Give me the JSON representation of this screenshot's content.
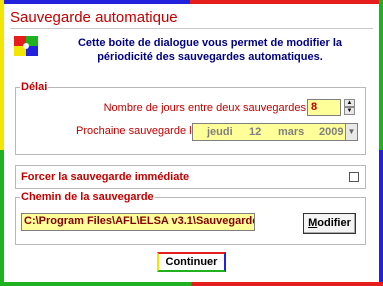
{
  "window": {
    "title": "Sauvegarde automatique",
    "intro_line1": "Cette boite de dialogue vous permet de modifier la",
    "intro_line2": "périodicité des sauvegardes automatiques."
  },
  "delai": {
    "group_label": "Délai",
    "jours_label": "Nombre de jours entre deux sauvegardes",
    "jours_value": "8",
    "prochaine_label": "Prochaine sauvegarde le",
    "date_weekday": "jeudi",
    "date_day": "12",
    "date_month": "mars",
    "date_year": "2009"
  },
  "forcer": {
    "label": "Forcer la sauvegarde immédiate",
    "checked": false
  },
  "chemin": {
    "group_label": "Chemin de la sauvegarde",
    "path_value": "C:\\Program Files\\AFL\\ELSA v3.1\\Sauvegarde",
    "modifier_label_first": "M",
    "modifier_label_rest": "odifier"
  },
  "footer": {
    "continuer_label": "Continuer"
  },
  "colors": {
    "title_red": "#c00000",
    "intro_blue": "#00007f",
    "field_yellow": "#ffff99",
    "border_yellow": "#f2e600",
    "border_green": "#1fb21f",
    "border_red": "#e51d1d",
    "border_blue": "#2222dd"
  },
  "icons": {
    "app_logo": "elsa-logo-icon",
    "spin_up": "spin-up-icon",
    "spin_down": "spin-down-icon",
    "date_dropdown": "chevron-down-icon"
  }
}
